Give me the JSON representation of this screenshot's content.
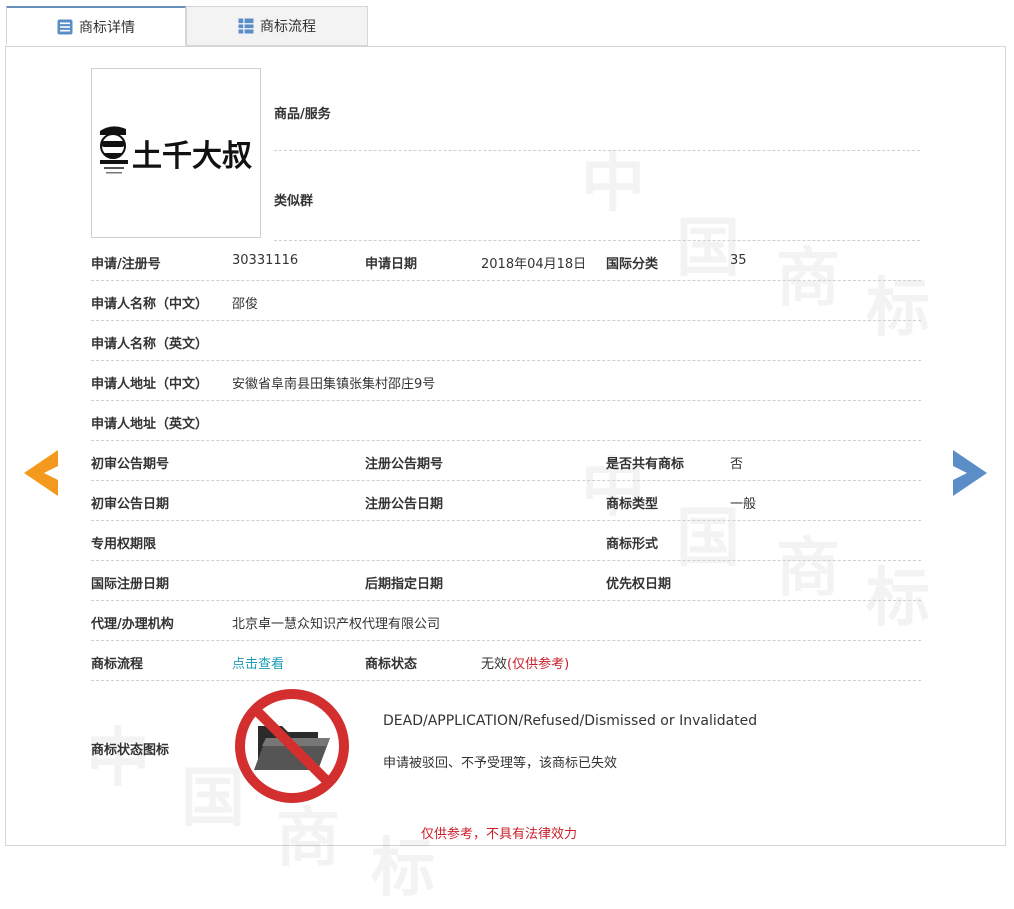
{
  "tabs": [
    {
      "label": "商标详情"
    },
    {
      "label": "商标流程"
    }
  ],
  "watermark_chars": [
    "中",
    "国",
    "商",
    "标"
  ],
  "logo": {
    "text": "土千大叔"
  },
  "side": {
    "goods_label": "商品/服务",
    "similar_label": "类似群"
  },
  "rows": [
    [
      {
        "label": "申请/注册号",
        "value": "30331116"
      },
      {
        "label": "申请日期",
        "value": "2018年04月18日"
      },
      {
        "label": "国际分类",
        "value": "35"
      }
    ],
    [
      {
        "label": "申请人名称（中文）",
        "value": "邵俊"
      }
    ],
    [
      {
        "label": "申请人名称（英文）",
        "value": ""
      }
    ],
    [
      {
        "label": "申请人地址（中文）",
        "value": "安徽省阜南县田集镇张集村邵庄9号"
      }
    ],
    [
      {
        "label": "申请人地址（英文）",
        "value": ""
      }
    ],
    [
      {
        "label": "初审公告期号",
        "value": ""
      },
      {
        "label": "注册公告期号",
        "value": ""
      },
      {
        "label": "是否共有商标",
        "value": "否"
      }
    ],
    [
      {
        "label": "初审公告日期",
        "value": ""
      },
      {
        "label": "注册公告日期",
        "value": ""
      },
      {
        "label": "商标类型",
        "value": "一般"
      }
    ],
    [
      {
        "label": "专用权期限",
        "value": ""
      },
      {
        "label": "",
        "value": ""
      },
      {
        "label": "商标形式",
        "value": ""
      }
    ],
    [
      {
        "label": "国际注册日期",
        "value": ""
      },
      {
        "label": "后期指定日期",
        "value": ""
      },
      {
        "label": "优先权日期",
        "value": ""
      }
    ],
    [
      {
        "label": "代理/办理机构",
        "value": "北京卓一慧众知识产权代理有限公司"
      }
    ],
    [
      {
        "label": "商标流程",
        "value": "点击查看"
      },
      {
        "label": "商标状态",
        "value": "无效",
        "note": "(仅供参考)"
      }
    ]
  ],
  "status_icon": {
    "label": "商标状态图标",
    "title": "DEAD/APPLICATION/Refused/Dismissed or Invalidated",
    "desc": "申请被驳回、不予受理等，该商标已失效"
  },
  "footer": "仅供参考，不具有法律效力",
  "colors": {
    "accent_blue": "#5b8ec7",
    "arrow_orange": "#f39a1e",
    "status_red": "#c8202b",
    "link_teal": "#1a9bb5"
  }
}
